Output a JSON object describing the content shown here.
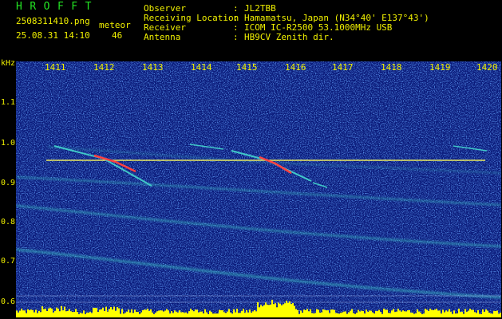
{
  "header": {
    "title": "HROFFT",
    "filename": "2508311410.png",
    "datetime": "25.08.31 14:10",
    "meteor_label": "meteor",
    "meteor_count": "46"
  },
  "info": [
    {
      "key": "Observer",
      "value": "JL2TBB"
    },
    {
      "key": "Receiving Location",
      "value": "Hamamatsu, Japan (N34°40' E137°43')"
    },
    {
      "key": "Receiver",
      "value": "ICOM IC-R2500 53.1000MHz USB"
    },
    {
      "key": "Antenna",
      "value": "HB9CV Zenith dir."
    }
  ],
  "axes": {
    "y_unit": "kHz",
    "y_ticks": [
      "1.1",
      "1.0",
      "0.9",
      "0.8",
      "0.7",
      "0.6"
    ],
    "x_ticks": [
      "1411",
      "1412",
      "1413",
      "1414",
      "1415",
      "1416",
      "1417",
      "1418",
      "1419",
      "1420"
    ]
  },
  "colors": {
    "label": "#f0f000",
    "title": "#23e323",
    "background": "#0a1a7a",
    "reference_line": "#e8e860",
    "meteor": "#ff4040",
    "signal_trail": "#40c8c8",
    "level_bar": "#ffff00"
  }
}
